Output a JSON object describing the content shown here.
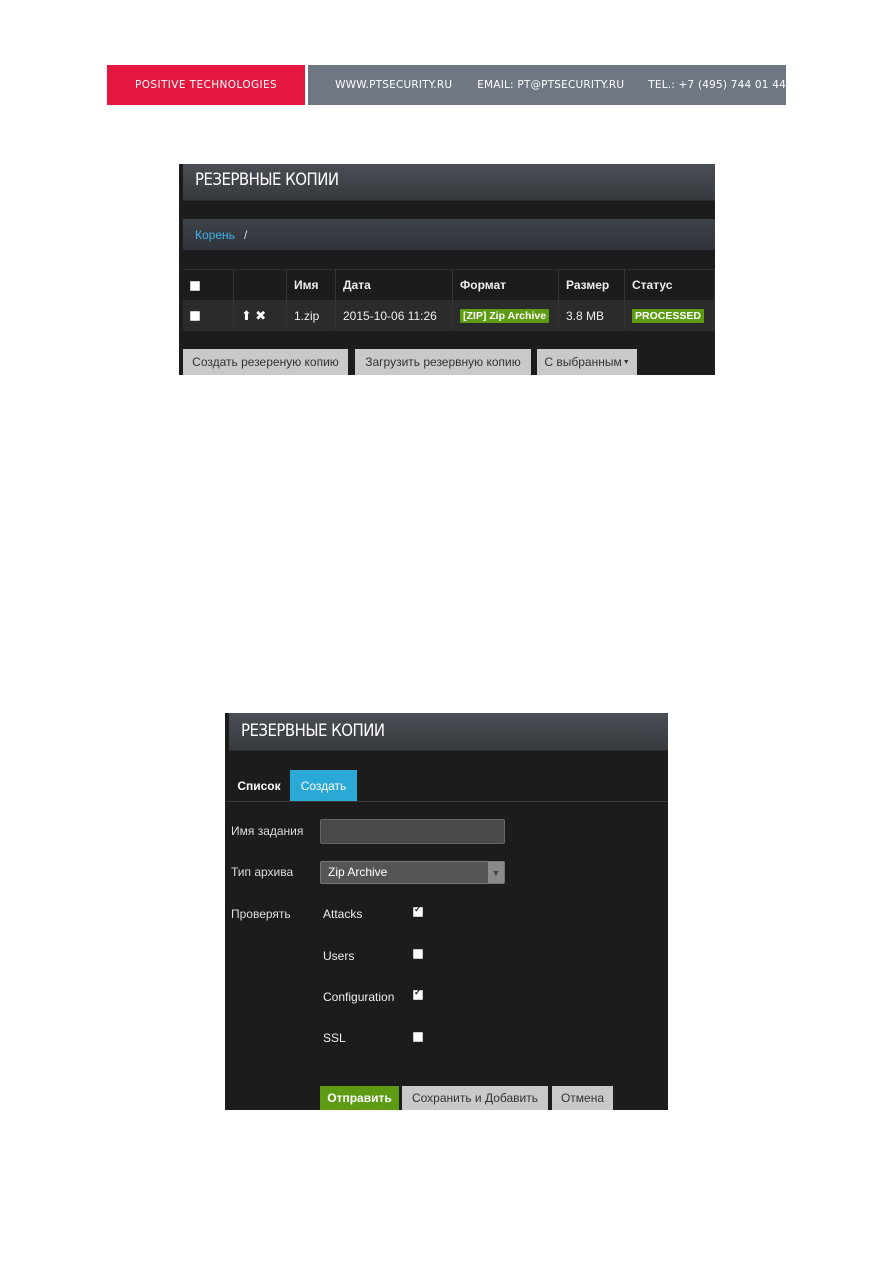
{
  "banner": {
    "brand": "POSITIVE TECHNOLOGIES",
    "website": "WWW.PTSECURITY.RU",
    "email": "EMAIL: PT@PTSECURITY.RU",
    "phone": "TEL.: +7 (495) 744 01 44",
    "colors": {
      "brand_bg": "#e4173e",
      "info_bg": "#6f7882"
    }
  },
  "backups_list": {
    "title": "РЕЗЕРВНЫЕ КОПИИ",
    "breadcrumb": {
      "root": "Корень",
      "separator": "/"
    },
    "columns": [
      "",
      "",
      "Имя",
      "Дата",
      "Формат",
      "Размер",
      "Статус"
    ],
    "rows": [
      {
        "checked": false,
        "actions": [
          "upload-icon",
          "delete-icon"
        ],
        "name": "1.zip",
        "date": "2015-10-06 11:26",
        "format": "[ZIP] Zip Archive",
        "size": "3.8 MB",
        "status": "PROCESSED"
      }
    ],
    "buttons": {
      "create": "Создать резереную копию",
      "upload": "Загрузить резервную копию",
      "with_selected": "С выбранным"
    }
  },
  "backup_create": {
    "title": "РЕЗЕРВНЫЕ КОПИИ",
    "tabs": {
      "list": "Список",
      "create": "Создать",
      "active": "create"
    },
    "form": {
      "job_name_label": "Имя задания",
      "job_name_value": "",
      "archive_type_label": "Тип архива",
      "archive_type_value": "Zip Archive",
      "check_label": "Проверять",
      "options": [
        {
          "label": "Attacks",
          "checked": true
        },
        {
          "label": "Users",
          "checked": false
        },
        {
          "label": "Configuration",
          "checked": true
        },
        {
          "label": "SSL",
          "checked": false
        }
      ]
    },
    "buttons": {
      "submit": "Отправить",
      "save_add": "Сохранить и Добавить",
      "cancel": "Отмена"
    },
    "colors": {
      "active_tab": "#2aa8d6",
      "primary_button": "#5d9b12"
    }
  }
}
